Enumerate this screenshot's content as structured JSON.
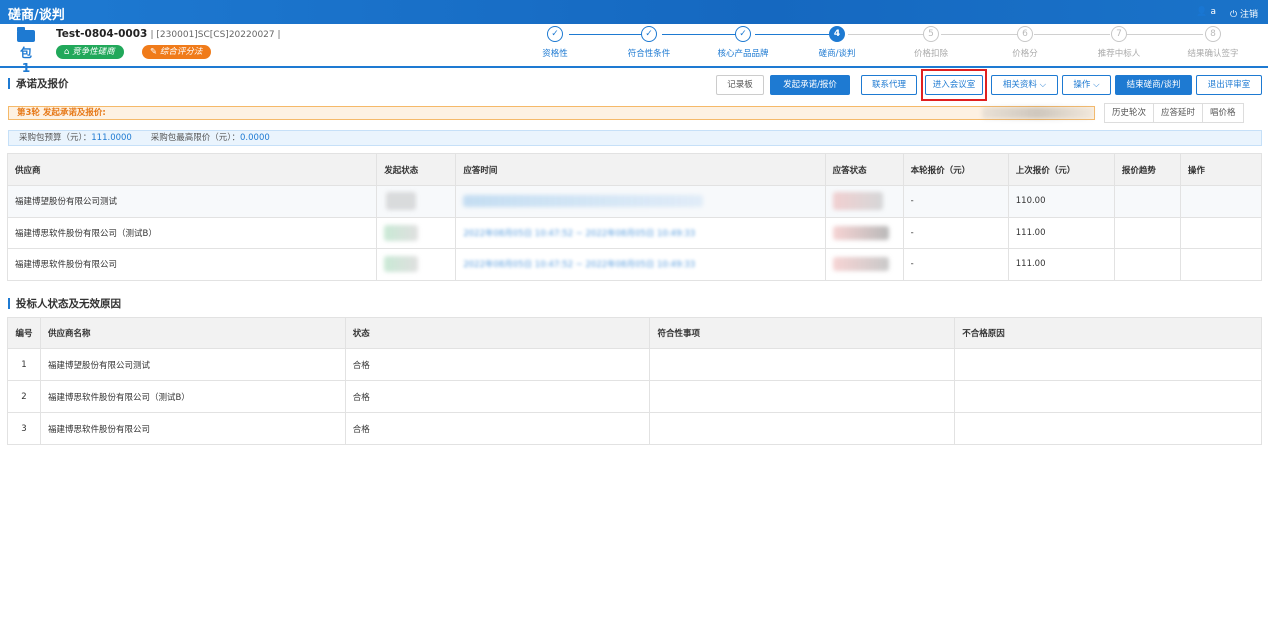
{
  "app": {
    "title": "磋商/谈判",
    "user": "a",
    "logout": "注销"
  },
  "package": {
    "label": "包1",
    "name": "Test-0804-0003",
    "code": "[230001]SC[CS]20220027",
    "badges": [
      "竞争性磋商",
      "综合评分法"
    ]
  },
  "steps": [
    {
      "num": "✓",
      "label": "资格性",
      "state": "done"
    },
    {
      "num": "✓",
      "label": "符合性条件",
      "state": "done"
    },
    {
      "num": "✓",
      "label": "核心产品品牌",
      "state": "done"
    },
    {
      "num": "4",
      "label": "磋商/谈判",
      "state": "current"
    },
    {
      "num": "5",
      "label": "价格扣除",
      "state": "todo"
    },
    {
      "num": "6",
      "label": "价格分",
      "state": "todo"
    },
    {
      "num": "7",
      "label": "推荐中标人",
      "state": "todo"
    },
    {
      "num": "8",
      "label": "结果确认签字",
      "state": "todo"
    }
  ],
  "section1": {
    "title": "承诺及报价",
    "buttons": {
      "record": "记录板",
      "initiate": "发起承诺/报价",
      "contact": "联系代理",
      "meeting": "进入会议室",
      "materials": "相关资料",
      "operate": "操作",
      "end": "结束磋商/谈判",
      "exit": "退出评审室"
    },
    "round_text": "第3轮 发起承诺及报价:",
    "round_tabs": [
      "历史轮次",
      "应答延时",
      "唱价格"
    ],
    "budget_label": "采购包预算（元）：",
    "budget_value": "111.0000",
    "max_label": "采购包最高限价（元）：",
    "max_value": "0.0000",
    "columns": [
      "供应商",
      "发起状态",
      "应答时间",
      "应答状态",
      "本轮报价（元）",
      "上次报价（元）",
      "报价趋势",
      "操作"
    ],
    "rows": [
      {
        "supplier": "福建博望股份有限公司测试",
        "time": "",
        "current": "-",
        "last": "110.00"
      },
      {
        "supplier": "福建博思软件股份有限公司（测试B）",
        "time": "2022年08月05日 10:47:52 ~ 2022年08月05日 10:49:33",
        "current": "-",
        "last": "111.00"
      },
      {
        "supplier": "福建博思软件股份有限公司",
        "time": "2022年08月05日 10:47:52 ~ 2022年08月05日 10:49:33",
        "current": "-",
        "last": "111.00"
      }
    ]
  },
  "section2": {
    "title": "投标人状态及无效原因",
    "columns": [
      "编号",
      "供应商名称",
      "状态",
      "符合性事项",
      "不合格原因"
    ],
    "rows": [
      {
        "no": "1",
        "name": "福建博望股份有限公司测试",
        "status": "合格"
      },
      {
        "no": "2",
        "name": "福建博思软件股份有限公司（测试B）",
        "status": "合格"
      },
      {
        "no": "3",
        "name": "福建博思软件股份有限公司",
        "status": "合格"
      }
    ]
  },
  "colors": {
    "primary": "#1e7ad2",
    "highlight": "#e02020",
    "orange": "#f07b1a",
    "green": "#21a85a"
  }
}
